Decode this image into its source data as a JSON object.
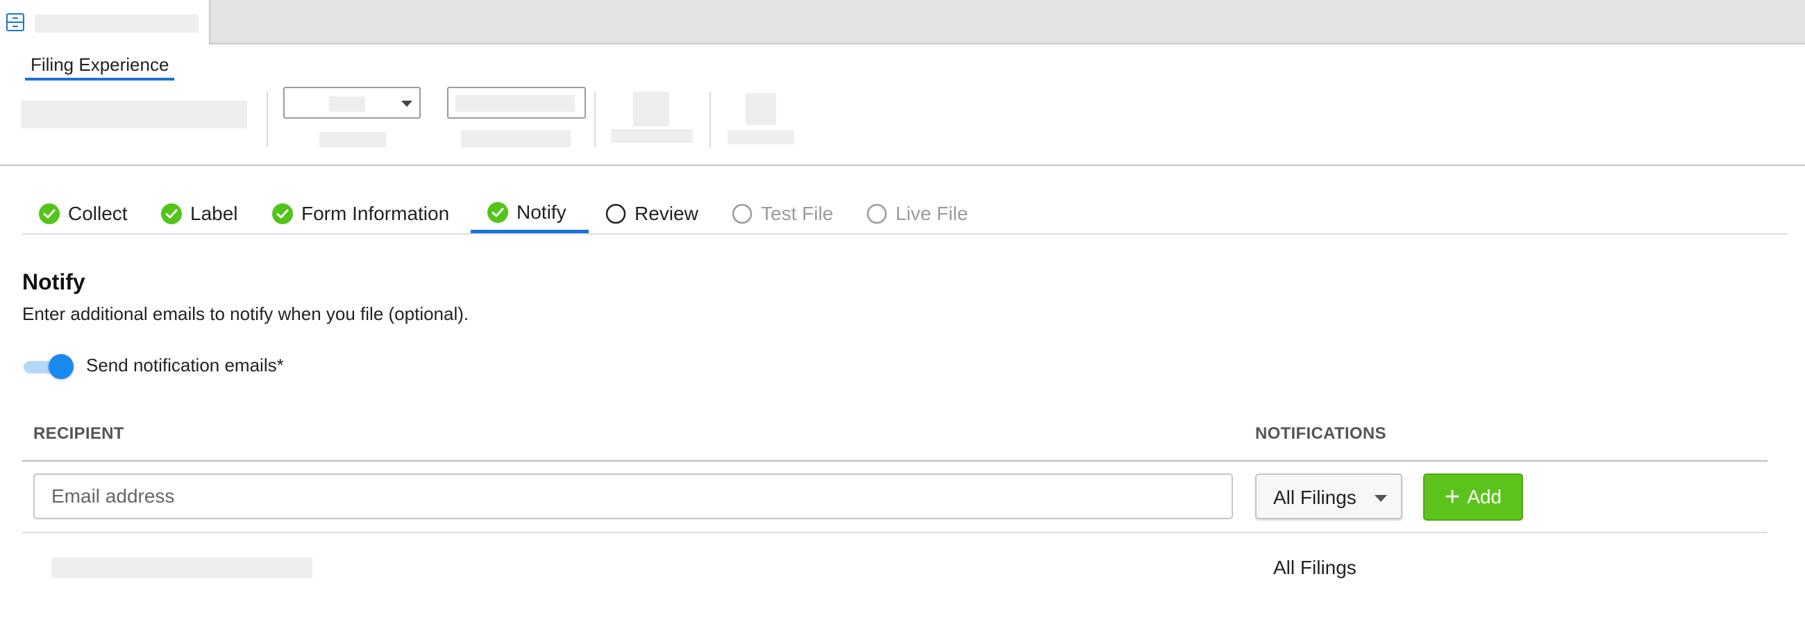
{
  "toolbar": {
    "page_tab_label": "Filing Experience"
  },
  "steps": [
    {
      "label": "Collect",
      "state": "complete"
    },
    {
      "label": "Label",
      "state": "complete"
    },
    {
      "label": "Form Information",
      "state": "complete"
    },
    {
      "label": "Notify",
      "state": "active-complete"
    },
    {
      "label": "Review",
      "state": "incomplete"
    },
    {
      "label": "Test File",
      "state": "disabled"
    },
    {
      "label": "Live File",
      "state": "disabled"
    }
  ],
  "notify": {
    "title": "Notify",
    "description": "Enter additional emails to notify when you file (optional).",
    "toggle_label": "Send notification emails*",
    "toggle_on": true
  },
  "table": {
    "col_recipient": "RECIPIENT",
    "col_notifications": "NOTIFICATIONS",
    "email_placeholder": "Email address",
    "notif_selected": "All Filings",
    "add_label": "Add",
    "rows": [
      {
        "recipient": "",
        "notifications": "All Filings"
      }
    ]
  },
  "colors": {
    "accent_blue": "#1a73d9",
    "check_green": "#52c41a",
    "add_green": "#5cc31b",
    "toggle_blue": "#1a8af0"
  }
}
